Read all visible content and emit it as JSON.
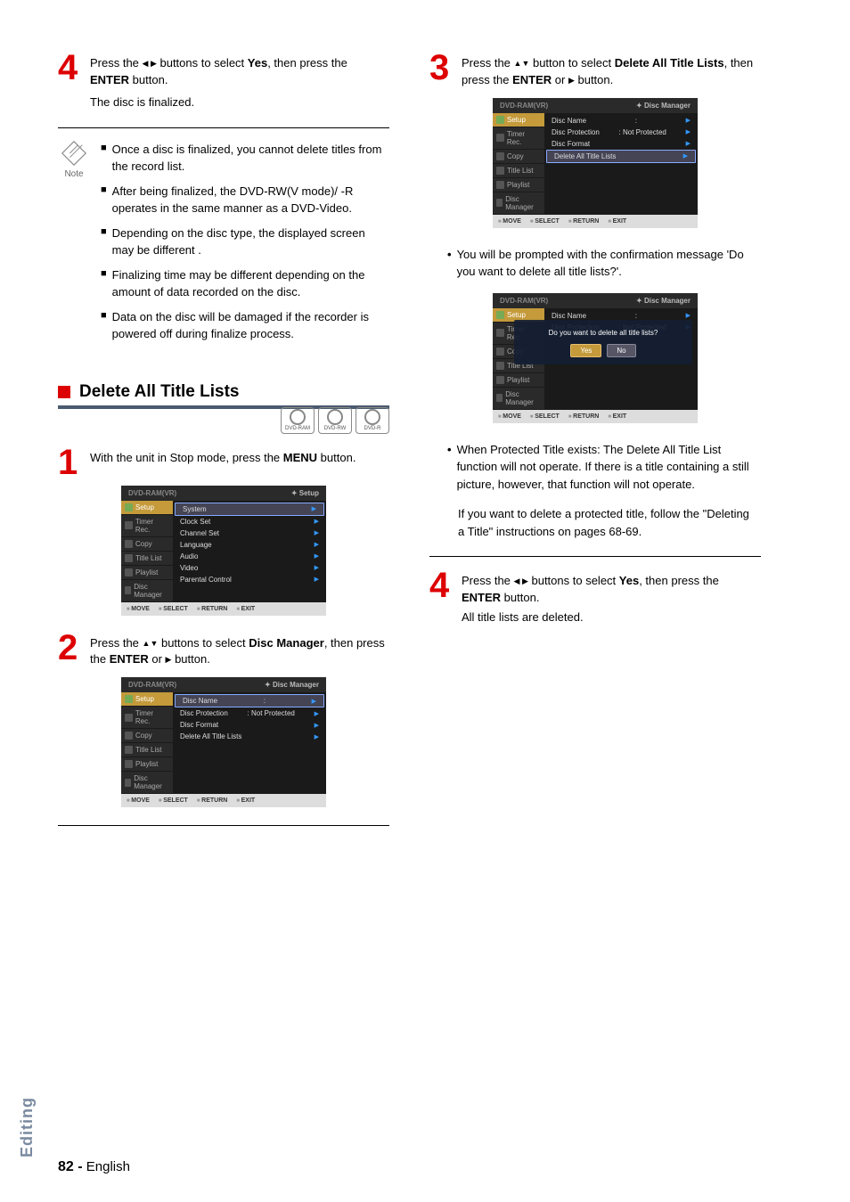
{
  "left": {
    "step4": {
      "num": "4",
      "text1": "Press the ",
      "text2": " buttons to select ",
      "yes": "Yes",
      "text3": ", then press the ",
      "enter": "ENTER",
      "text4": " button."
    },
    "step4_sub": "The disc is finalized.",
    "note_label": "Note",
    "notes": [
      "Once a disc is finalized, you cannot delete titles from the record list.",
      "After being finalized, the DVD-RW(V mode)/ -R operates in the same manner as a DVD-Video.",
      "Depending on the disc type, the displayed screen may be different .",
      "Finalizing time may be different depending on the amount of data recorded on the disc.",
      "Data on the disc will be damaged if the recorder is powered off during finalize process."
    ],
    "section_title": "Delete All Title Lists",
    "discs": [
      "DVD-RAM",
      "DVD-RW",
      "DVD-R"
    ],
    "step1": {
      "num": "1",
      "text1": "With the unit in Stop mode, press the ",
      "menu": "MENU",
      "text2": " button."
    },
    "osd1": {
      "title_l": "DVD-RAM(VR)",
      "title_r": "Setup",
      "nav": [
        "Setup",
        "Timer Rec.",
        "Copy",
        "Title List",
        "Playlist",
        "Disc Manager"
      ],
      "rows": [
        {
          "l": "System",
          "r": ""
        },
        {
          "l": "Clock Set",
          "r": ""
        },
        {
          "l": "Channel Set",
          "r": ""
        },
        {
          "l": "Language",
          "r": ""
        },
        {
          "l": "Audio",
          "r": ""
        },
        {
          "l": "Video",
          "r": ""
        },
        {
          "l": "Parental Control",
          "r": ""
        }
      ],
      "foot": [
        "MOVE",
        "SELECT",
        "RETURN",
        "EXIT"
      ]
    },
    "step2": {
      "num": "2",
      "text1": "Press the ",
      "text2": " buttons to select ",
      "dm": "Disc Manager",
      "text3": ", then press the ",
      "enter": "ENTER",
      "text4": " or ",
      "text5": " button."
    },
    "osd2": {
      "title_l": "DVD-RAM(VR)",
      "title_r": "Disc Manager",
      "nav": [
        "Setup",
        "Timer Rec.",
        "Copy",
        "Title List",
        "Playlist",
        "Disc Manager"
      ],
      "rows": [
        {
          "l": "Disc Name",
          "r": ":",
          "hl": true
        },
        {
          "l": "Disc Protection",
          "r": ": Not Protected"
        },
        {
          "l": "Disc Format",
          "r": ""
        },
        {
          "l": "Delete All Title Lists",
          "r": ""
        }
      ],
      "foot": [
        "MOVE",
        "SELECT",
        "RETURN",
        "EXIT"
      ]
    }
  },
  "right": {
    "step3": {
      "num": "3",
      "text1": "Press the ",
      "text2": " button to select ",
      "dat": "Delete All Title Lists",
      "text3": ", then press the ",
      "enter": "ENTER",
      "text4": " or ",
      "text5": " button."
    },
    "osd3": {
      "title_l": "DVD-RAM(VR)",
      "title_r": "Disc Manager",
      "nav": [
        "Setup",
        "Timer Rec.",
        "Copy",
        "Title List",
        "Playlist",
        "Disc Manager"
      ],
      "rows": [
        {
          "l": "Disc Name",
          "r": ":"
        },
        {
          "l": "Disc Protection",
          "r": ": Not Protected"
        },
        {
          "l": "Disc Format",
          "r": ""
        },
        {
          "l": "Delete All Title Lists",
          "r": "",
          "hl": true
        }
      ],
      "foot": [
        "MOVE",
        "SELECT",
        "RETURN",
        "EXIT"
      ]
    },
    "bullet1": "You will be prompted with the confirmation message 'Do you want to delete all title lists?'.",
    "osd4": {
      "title_l": "DVD-RAM(VR)",
      "title_r": "Disc Manager",
      "nav": [
        "Setup",
        "Timer Rec.",
        "Copy",
        "Title List",
        "Playlist",
        "Disc Manager"
      ],
      "rows": [
        {
          "l": "Disc Name",
          "r": ":"
        },
        {
          "l": "Disc Protection",
          "r": ": Not Protected"
        },
        {
          "l": "Disc Format",
          "r": ""
        },
        {
          "l": "Delete All Title Lists",
          "r": ""
        }
      ],
      "dialog_msg": "Do you want to delete all title lists?",
      "btn_yes": "Yes",
      "btn_no": "No",
      "foot": [
        "MOVE",
        "SELECT",
        "RETURN",
        "EXIT"
      ]
    },
    "bullet2": "When Protected Title exists: The Delete All Title List function will not operate. If there is a title containing a still picture, however, that function will not operate.",
    "bullet2b": "If you want to delete a protected title, follow the \"Deleting a Title\" instructions on pages 68-69.",
    "step4": {
      "num": "4",
      "text1": "Press the ",
      "text2": " buttons to select ",
      "yes": "Yes",
      "text3": ", then press the ",
      "enter": "ENTER",
      "text4": " button."
    },
    "step4_sub": "All title lists are deleted."
  },
  "tab": "Editing",
  "pagenum": "82 -",
  "pagelang": "English"
}
